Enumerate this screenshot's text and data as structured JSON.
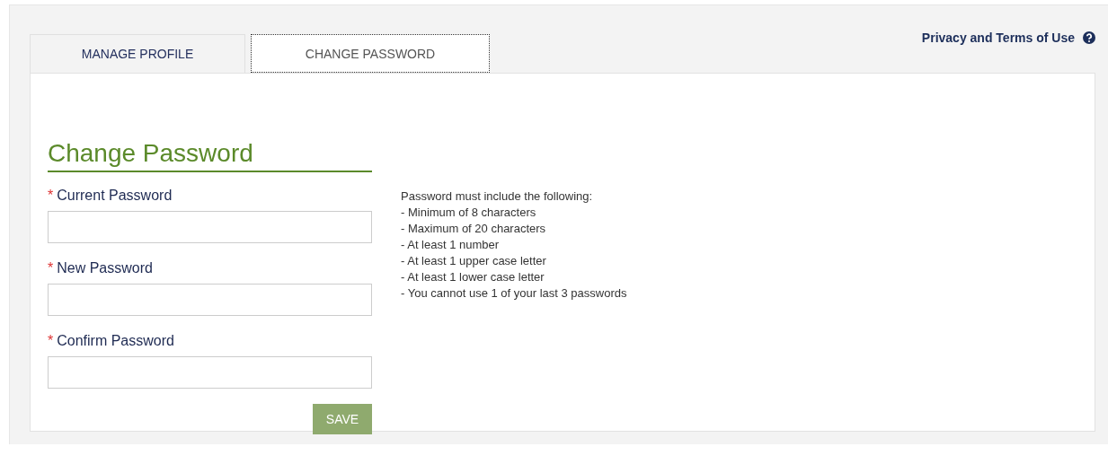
{
  "header_link": {
    "label": "Privacy and Terms of Use"
  },
  "tabs": [
    {
      "label": "MANAGE PROFILE",
      "selected": false
    },
    {
      "label": "CHANGE PASSWORD",
      "selected": true
    }
  ],
  "form": {
    "title": "Change Password",
    "fields": [
      {
        "label": "Current Password",
        "required_mark": "*"
      },
      {
        "label": "New Password",
        "required_mark": "*"
      },
      {
        "label": "Confirm Password",
        "required_mark": "*"
      }
    ],
    "save_button": "SAVE"
  },
  "requirements": {
    "heading": "Password must include the following:",
    "items": [
      "- Minimum of 8 characters",
      "- Maximum of 20 characters",
      "- At least 1 number",
      "- At least 1 upper case letter",
      "- At least 1 lower case letter",
      "- You cannot use 1 of your last 3 passwords"
    ]
  }
}
